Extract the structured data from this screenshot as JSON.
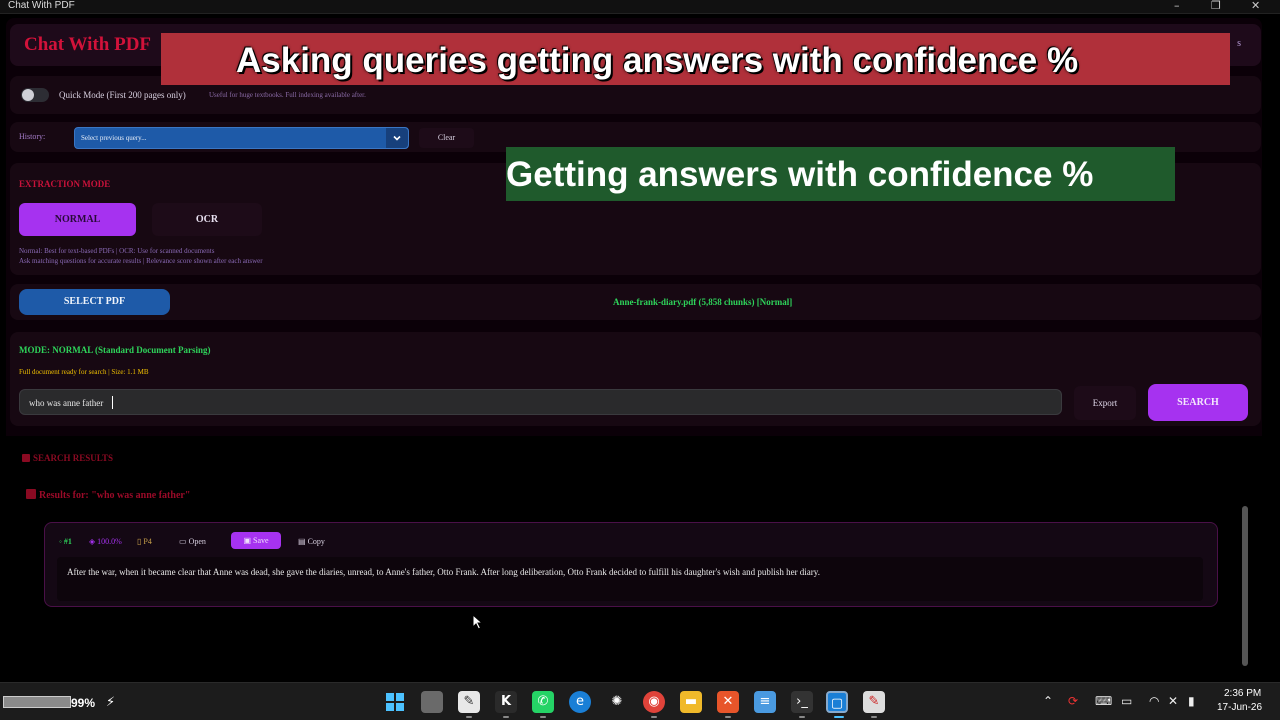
{
  "window": {
    "title": "Chat With PDF",
    "minimize_glyph": "–",
    "maximize_glyph": "❐",
    "close_glyph": "✕"
  },
  "header": {
    "brand": "Chat With PDF",
    "right_fragment": "s"
  },
  "overlays": {
    "red_banner": "Asking queries getting answers with confidence %",
    "green_banner": "Getting answers with confidence %"
  },
  "quick_mode": {
    "label": "Quick Mode (First 200 pages only)",
    "hint": "Useful for huge textbooks. Full indexing available after.",
    "enabled": false
  },
  "history": {
    "label": "History:",
    "selected": "Select previous query...",
    "chevron_icon": "chevron-down-icon",
    "clear_label": "Clear"
  },
  "extraction": {
    "title": "EXTRACTION MODE",
    "normal_label": "NORMAL",
    "ocr_label": "OCR",
    "active": "NORMAL",
    "hint1": "Normal: Best for text-based PDFs  |  OCR: Use for scanned documents",
    "hint2": "Ask matching questions for accurate results  |  Relevance score shown after each answer"
  },
  "pdf": {
    "select_label": "SELECT PDF",
    "file_info": "Anne-frank-diary.pdf (5,858 chunks) [Normal]"
  },
  "search": {
    "mode_text": "MODE: NORMAL (Standard Document Parsing)",
    "status_text": "Full document ready for search | Size: 1.1 MB",
    "query_value": "who was anne father",
    "export_label": "Export",
    "search_label": "SEARCH"
  },
  "results": {
    "section_title": "SEARCH RESULTS",
    "results_for": "Results for: \"who was anne father\"",
    "items": [
      {
        "rank": "#1",
        "confidence": "100.0%",
        "page": "P4",
        "open_label": "Open",
        "save_label": "Save",
        "copy_label": "Copy",
        "text": "After the war, when it became clear that Anne was dead, she gave the diaries, unread, to Anne's father, Otto Frank. After long deliberation, Otto Frank decided to fulfill his daughter's wish and publish her diary."
      }
    ]
  },
  "taskbar": {
    "battery_text": "99%",
    "time": "2:36 PM",
    "date": "17-Jun-26"
  },
  "colors": {
    "accent_purple": "#a632f0",
    "accent_blue": "#1e5aa8",
    "success_green": "#2ed35a",
    "brand_red": "#d2123a",
    "status_yellow": "#f0c000"
  }
}
